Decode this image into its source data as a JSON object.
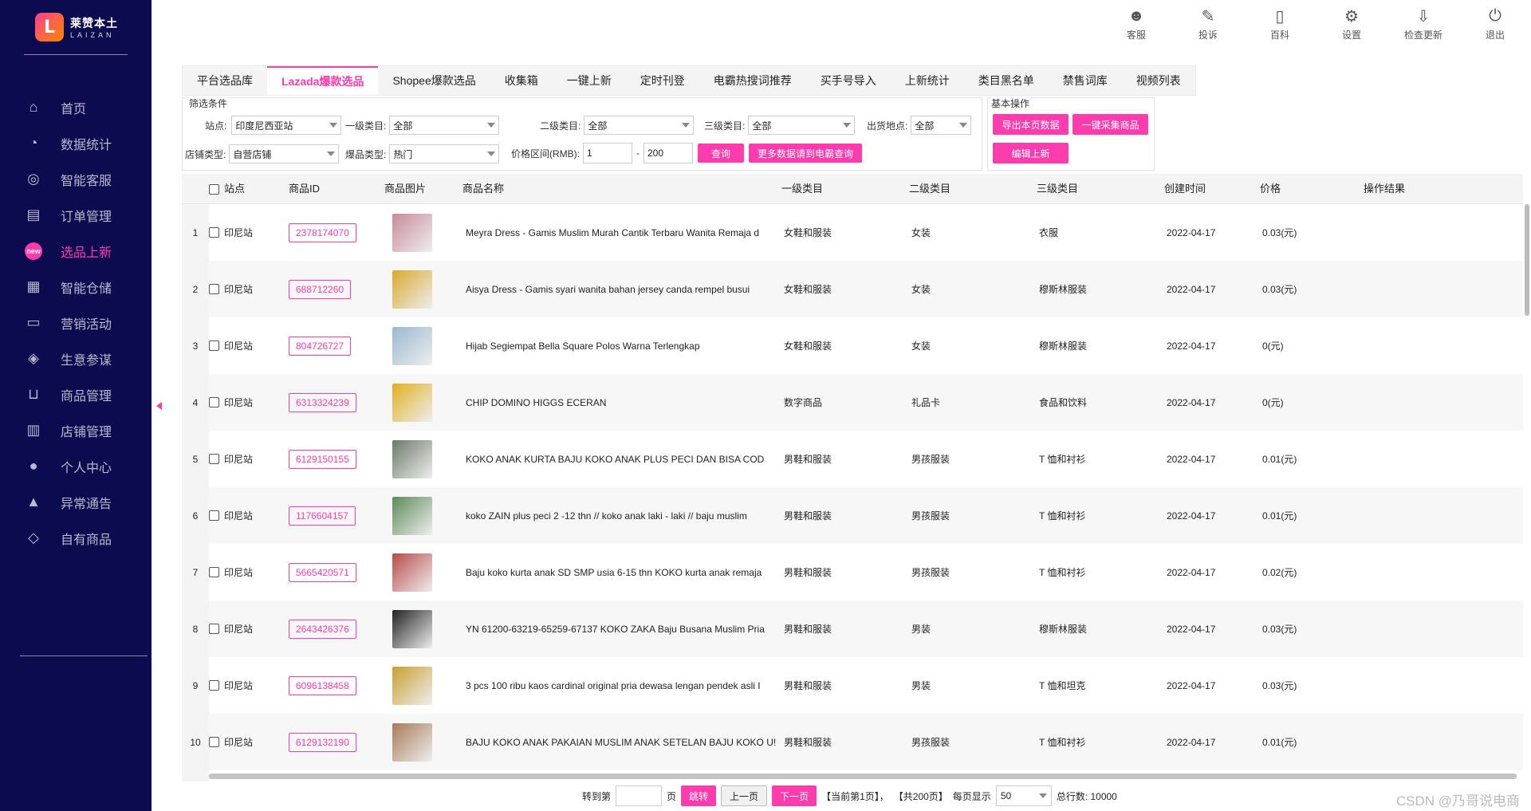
{
  "app": {
    "logo_cn": "莱赞本土",
    "logo_en": "LAIZAN",
    "logo_mark": "L"
  },
  "nav": [
    {
      "label": "首页",
      "icon": "home-icon",
      "glyph": "⌂"
    },
    {
      "label": "数据统计",
      "icon": "pie-chart-icon",
      "glyph": "◔"
    },
    {
      "label": "智能客服",
      "icon": "chat-icon",
      "glyph": "◎"
    },
    {
      "label": "订单管理",
      "icon": "order-list-icon",
      "glyph": "▤"
    },
    {
      "label": "选品上新",
      "icon": "new-badge-icon",
      "glyph": "new",
      "active": true
    },
    {
      "label": "智能仓储",
      "icon": "warehouse-icon",
      "glyph": "▦"
    },
    {
      "label": "营销活动",
      "icon": "sale-tag-icon",
      "glyph": "▭"
    },
    {
      "label": "生意参谋",
      "icon": "compass-icon",
      "glyph": "◈"
    },
    {
      "label": "商品管理",
      "icon": "inbox-icon",
      "glyph": "⊔"
    },
    {
      "label": "店铺管理",
      "icon": "store-icon",
      "glyph": "▥"
    },
    {
      "label": "个人中心",
      "icon": "user-icon",
      "glyph": "●"
    },
    {
      "label": "异常通告",
      "icon": "warning-icon",
      "glyph": "▲"
    },
    {
      "label": "自有商品",
      "icon": "tag-icon",
      "glyph": "◇"
    }
  ],
  "toolbar": [
    {
      "label": "客服",
      "icon": "customer-service-icon",
      "glyph": "☻"
    },
    {
      "label": "投诉",
      "icon": "complaint-icon",
      "glyph": "✎"
    },
    {
      "label": "百科",
      "icon": "book-icon",
      "glyph": "▯"
    },
    {
      "label": "设置",
      "icon": "gear-icon",
      "glyph": "⚙"
    },
    {
      "label": "检查更新",
      "icon": "download-icon",
      "glyph": "⇩"
    },
    {
      "label": "退出",
      "icon": "power-icon",
      "glyph": "⏻"
    }
  ],
  "tabs": [
    {
      "label": "平台选品库"
    },
    {
      "label": "Lazada爆款选品",
      "active": true
    },
    {
      "label": "Shopee爆款选品"
    },
    {
      "label": "收集箱"
    },
    {
      "label": "一键上新"
    },
    {
      "label": "定时刊登"
    },
    {
      "label": "电霸热搜词推荐"
    },
    {
      "label": "买手号导入"
    },
    {
      "label": "上新统计"
    },
    {
      "label": "类目黑名单"
    },
    {
      "label": "禁售词库"
    },
    {
      "label": "视频列表"
    }
  ],
  "filter": {
    "title": "筛选条件",
    "site_label": "站点:",
    "site_value": "印度尼西亚站",
    "cat1_label": "一级类目:",
    "cat1_value": "全部",
    "cat2_label": "二级类目:",
    "cat2_value": "全部",
    "cat3_label": "三级类目:",
    "cat3_value": "全部",
    "ship_label": "出货地点:",
    "ship_value": "全部",
    "store_label": "店铺类型:",
    "store_value": "自营店铺",
    "hot_label": "爆品类型:",
    "hot_value": "热门",
    "price_label": "价格区间(RMB):",
    "price_min": "1",
    "price_sep": "-",
    "price_max": "200",
    "query_btn": "查询",
    "more_btn": "更多数据请到电霸查询"
  },
  "ops": {
    "title": "基本操作",
    "export_btn": "导出本页数据",
    "collect_btn": "一键采集商品",
    "edit_btn": "编辑上新"
  },
  "table": {
    "headers": {
      "site": "站点",
      "pid": "商品ID",
      "img": "商品图片",
      "name": "商品名称",
      "cat1": "一级类目",
      "cat2": "二级类目",
      "cat3": "三级类目",
      "created": "创建时间",
      "price": "价格",
      "result": "操作结果"
    },
    "rows": [
      {
        "n": "1",
        "site": "印尼站",
        "pid": "2378174070",
        "name": "Meyra Dress - Gamis Muslim Murah Cantik Terbaru Wanita Remaja d",
        "cat1": "女鞋和服装",
        "cat2": "女装",
        "cat3": "衣服",
        "created": "2022-04-17",
        "price": "0.03(元)",
        "thumb": "#c98a9a"
      },
      {
        "n": "2",
        "site": "印尼站",
        "pid": "688712260",
        "name": "Aisya Dress - Gamis syari wanita bahan jersey canda rempel busui",
        "cat1": "女鞋和服装",
        "cat2": "女装",
        "cat3": "穆斯林服装",
        "created": "2022-04-17",
        "price": "0.03(元)",
        "thumb": "#d9a92a"
      },
      {
        "n": "3",
        "site": "印尼站",
        "pid": "804726727",
        "name": "Hijab Segiempat Bella Square Polos Warna Terlengkap",
        "cat1": "女鞋和服装",
        "cat2": "女装",
        "cat3": "穆斯林服装",
        "created": "2022-04-17",
        "price": "0(元)",
        "thumb": "#9ab8cf"
      },
      {
        "n": "4",
        "site": "印尼站",
        "pid": "6313324239",
        "name": "CHIP DOMINO HIGGS ECERAN",
        "cat1": "数字商品",
        "cat2": "礼品卡",
        "cat3": "食品和饮料",
        "created": "2022-04-17",
        "price": "0(元)",
        "thumb": "#e0b020"
      },
      {
        "n": "5",
        "site": "印尼站",
        "pid": "6129150155",
        "name": "KOKO ANAK KURTA BAJU KOKO ANAK PLUS PECI DAN BISA COD",
        "cat1": "男鞋和服装",
        "cat2": "男孩服装",
        "cat3": "T 恤和衬衫",
        "created": "2022-04-17",
        "price": "0.01(元)",
        "thumb": "#6b7a6a"
      },
      {
        "n": "6",
        "site": "印尼站",
        "pid": "1176604157",
        "name": "koko ZAIN plus peci 2 -12 thn // koko anak laki - laki // baju muslim",
        "cat1": "男鞋和服装",
        "cat2": "男孩服装",
        "cat3": "T 恤和衬衫",
        "created": "2022-04-17",
        "price": "0.01(元)",
        "thumb": "#5d8a5a"
      },
      {
        "n": "7",
        "site": "印尼站",
        "pid": "5665420571",
        "name": "Baju koko kurta anak SD SMP usia 6-15 thn KOKO kurta anak remaja",
        "cat1": "男鞋和服装",
        "cat2": "男孩服装",
        "cat3": "T 恤和衬衫",
        "created": "2022-04-17",
        "price": "0.02(元)",
        "thumb": "#b84a4a"
      },
      {
        "n": "8",
        "site": "印尼站",
        "pid": "2643426376",
        "name": "YN 61200-63219-65259-67137 KOKO ZAKA Baju Busana Muslim Pria",
        "cat1": "男鞋和服装",
        "cat2": "男装",
        "cat3": "穆斯林服装",
        "created": "2022-04-17",
        "price": "0.03(元)",
        "thumb": "#222222"
      },
      {
        "n": "9",
        "site": "印尼站",
        "pid": "6096138458",
        "name": "3 pcs 100 ribu kaos cardinal original pria dewasa lengan pendek asli I",
        "cat1": "男鞋和服装",
        "cat2": "男装",
        "cat3": "T 恤和坦克",
        "created": "2022-04-17",
        "price": "0.03(元)",
        "thumb": "#c9a030"
      },
      {
        "n": "10",
        "site": "印尼站",
        "pid": "6129132190",
        "name": "BAJU KOKO ANAK PAKAIAN MUSLIM ANAK SETELAN BAJU KOKO U!",
        "cat1": "男鞋和服装",
        "cat2": "男孩服装",
        "cat3": "T 恤和衬衫",
        "created": "2022-04-17",
        "price": "0.01(元)",
        "thumb": "#a87a5a"
      }
    ]
  },
  "pager": {
    "goto_label": "转到第",
    "page_unit": "页",
    "jump_btn": "跳转",
    "prev_btn": "上一页",
    "next_btn": "下一页",
    "current": "【当前第1页】，",
    "total_pages": "【共200页】",
    "per_page_label": "每页显示",
    "per_page": "50",
    "total_label": "总行数: 10000"
  },
  "watermark": "CSDN @乃哥说电商"
}
